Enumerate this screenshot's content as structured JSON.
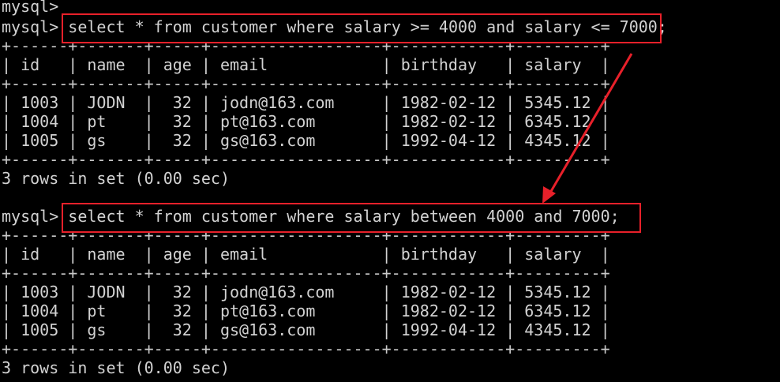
{
  "terminal": {
    "prompt_empty": "mysql>",
    "prompt": "mysql>",
    "query1": "select * from customer where salary >= 4000 and salary <= 7000;",
    "query2": "select * from customer where salary between 4000 and 7000;",
    "separator": "+------+-------+-----+------------------+------------+---------+",
    "header_row": "| id   | name  | age | email            | birthday   | salary  |",
    "rows": [
      "| 1003 | JODN  |  32 | jodn@163.com     | 1982-02-12 | 5345.12 |",
      "| 1004 | pt    |  32 | pt@163.com       | 1982-02-12 | 6345.12 |",
      "| 1005 | gs    |  32 | gs@163.com       | 1992-04-12 | 4345.12 |"
    ],
    "result_summary": "3 rows in set (0.00 sec)"
  },
  "annotation": {
    "box_color": "#e8202a",
    "arrow_color": "#e8202a"
  }
}
